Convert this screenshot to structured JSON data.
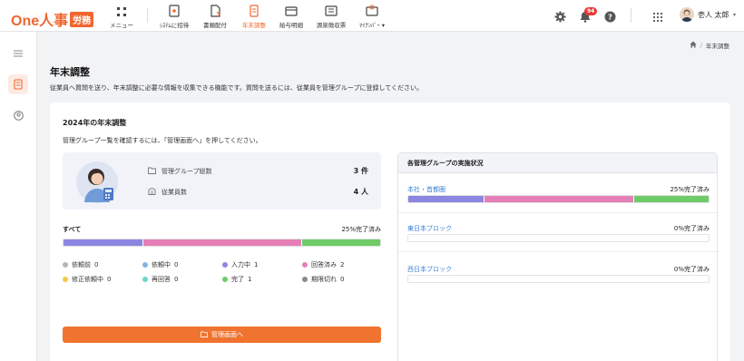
{
  "header": {
    "logo_text": "One人事",
    "logo_badge": "労務",
    "nav": [
      {
        "label": "メニュー",
        "icon": "grid-icon"
      },
      {
        "label": "ｼｽﾃﾑに招待",
        "icon": "invite-icon"
      },
      {
        "label": "書類配付",
        "icon": "document-icon"
      },
      {
        "label": "年末調整",
        "icon": "year-end-icon",
        "active": true
      },
      {
        "label": "給与明細",
        "icon": "payslip-icon"
      },
      {
        "label": "源泉徴収票",
        "icon": "withholding-icon"
      },
      {
        "label": "ﾏｲﾅﾝﾊﾞｰ",
        "icon": "mynumber-icon",
        "has_dropdown": true
      }
    ],
    "notification_count": "94",
    "user_name": "壱人 太郎"
  },
  "breadcrumb": {
    "current": "年末調整"
  },
  "page": {
    "title": "年末調整",
    "description": "従業員へ質問を送り、年末調整に必要な情報を収集できる機能です。質問を送るには、従業員を管理グループに登録してください。"
  },
  "card": {
    "title": "2024年の年末調整",
    "description": "管理グループ一覧を確認するには、「管理画面へ」を押してください。",
    "stats": [
      {
        "label": "管理グループ総数",
        "value": "3 件",
        "icon": "folder-icon"
      },
      {
        "label": "従業員数",
        "value": "4 人",
        "icon": "building-icon"
      }
    ],
    "overall": {
      "label": "すべて",
      "percent_text": "25%完了済み",
      "segments": [
        {
          "key": "in_progress",
          "fraction": 0.25,
          "color": "#8b86e0"
        },
        {
          "key": "answered",
          "fraction": 0.5,
          "color": "#e57fb8"
        },
        {
          "key": "completed",
          "fraction": 0.25,
          "color": "#6fcb68"
        }
      ]
    },
    "legend": [
      {
        "label": "依頼前",
        "count": "0",
        "color": "#b5b5b5"
      },
      {
        "label": "依頼中",
        "count": "0",
        "color": "#7fb6e6"
      },
      {
        "label": "入力中",
        "count": "1",
        "color": "#8b86e0"
      },
      {
        "label": "回答済み",
        "count": "2",
        "color": "#e57fb8"
      },
      {
        "label": "修正依頼中",
        "count": "0",
        "color": "#f5c84a"
      },
      {
        "label": "再回答",
        "count": "0",
        "color": "#6fd6c8"
      },
      {
        "label": "完了",
        "count": "1",
        "color": "#6fcb68"
      },
      {
        "label": "期限切れ",
        "count": "0",
        "color": "#8a8a8a"
      }
    ],
    "manage_button": "管理画面へ"
  },
  "groups_panel": {
    "title": "各管理グループの実施状況",
    "groups": [
      {
        "name": "本社・首都圏",
        "percent_text": "25%完了済み",
        "segments": [
          {
            "fraction": 0.25,
            "color": "#8b86e0"
          },
          {
            "fraction": 0.5,
            "color": "#e57fb8"
          },
          {
            "fraction": 0.25,
            "color": "#6fcb68"
          }
        ]
      },
      {
        "name": "東日本ブロック",
        "percent_text": "0%完了済み",
        "segments": []
      },
      {
        "name": "西日本ブロック",
        "percent_text": "0%完了済み",
        "segments": []
      }
    ]
  }
}
